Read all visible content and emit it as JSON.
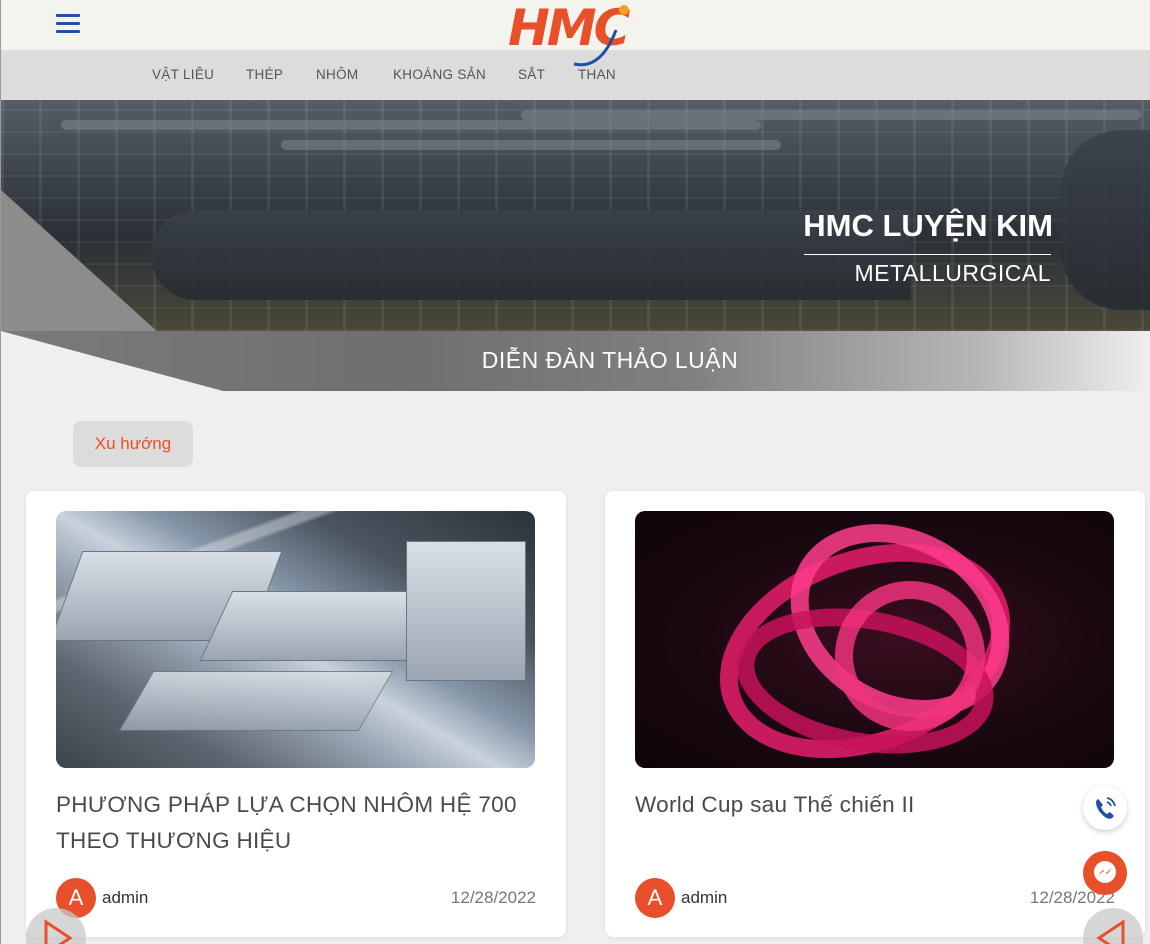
{
  "header": {
    "logo_text": "HMC",
    "menu_icon": "hamburger-menu-icon",
    "brand_color": "#e8502b",
    "accent_color": "#1e50a8"
  },
  "nav": {
    "items": [
      {
        "label": "VẬT LIÊU"
      },
      {
        "label": "THÉP"
      },
      {
        "label": "NHÔM"
      },
      {
        "label": "KHOÁNG SẢN"
      },
      {
        "label": "SẮT"
      },
      {
        "label": "THAN"
      }
    ]
  },
  "hero": {
    "title": "HMC LUYỆN KIM",
    "subtitle": "METALLURGICAL"
  },
  "banner": {
    "title": "DIỄN ĐÀN THẢO LUẬN"
  },
  "filter": {
    "label": "Xu hướng"
  },
  "posts": [
    {
      "title": "PHƯƠNG PHÁP LỰA CHỌN NHÔM HỆ 700 THEO THƯƠNG HIỆU",
      "avatar_letter": "A",
      "author": "admin",
      "date": "12/28/2022"
    },
    {
      "title": "World Cup sau Thế chiến II",
      "avatar_letter": "A",
      "author": "admin",
      "date": "12/28/2022"
    }
  ],
  "floating": {
    "phone_icon": "phone-icon",
    "messenger_icon": "messenger-icon",
    "prev_icon": "arrow-right-icon",
    "next_icon": "arrow-left-icon"
  }
}
